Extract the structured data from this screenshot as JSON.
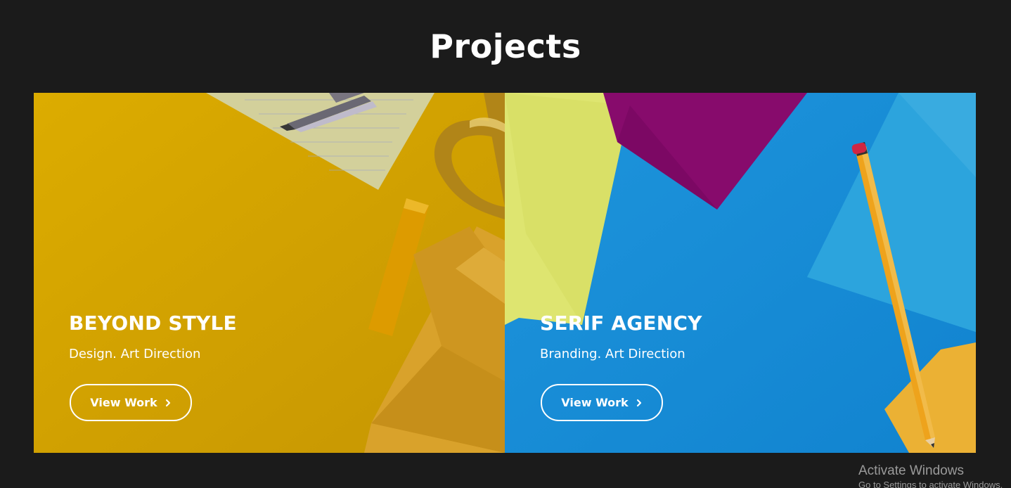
{
  "section": {
    "title": "Projects"
  },
  "projects": [
    {
      "title": "BEYOND STYLE",
      "subtitle": "Design. Art Direction",
      "button_label": "View Work",
      "icon": "chevron-right-icon",
      "background_color": "#dcaa05"
    },
    {
      "title": "SERIF AGENCY",
      "subtitle": "Branding. Art Direction",
      "button_label": "View Work",
      "icon": "chevron-right-icon",
      "background_color": "#1a92de"
    }
  ],
  "watermark": {
    "title": "Activate Windows",
    "subtitle": "Go to Settings to activate Windows."
  }
}
